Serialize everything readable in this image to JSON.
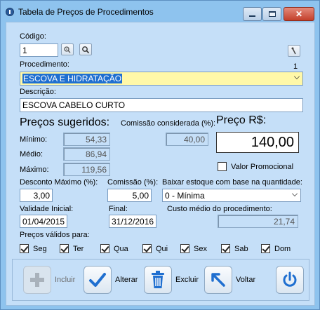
{
  "window": {
    "title": "Tabela de Preços de Procedimentos"
  },
  "codigo": {
    "label": "Código:",
    "value": "1"
  },
  "counter": "1",
  "procedimento": {
    "label": "Procedimento:",
    "value": "ESCOVA E HIDRATAÇÃO"
  },
  "descricao": {
    "label": "Descrição:",
    "value": "ESCOVA CABELO CURTO"
  },
  "precos_sugeridos": {
    "title": "Preços sugeridos:",
    "minimo_label": "Mínimo:",
    "minimo": "54,33",
    "medio_label": "Médio:",
    "medio": "86,94",
    "maximo_label": "Máximo:",
    "maximo": "119,56"
  },
  "comissao_considerada": {
    "label": "Comissão considerada (%):",
    "value": "40,00"
  },
  "preco": {
    "label": "Preço R$:",
    "value": "140,00"
  },
  "valor_promocional": {
    "label": "Valor Promocional",
    "checked": false
  },
  "desconto": {
    "label": "Desconto Máximo (%):",
    "value": "3,00"
  },
  "comissao": {
    "label": "Comissão (%):",
    "value": "5,00"
  },
  "baixar_estoque": {
    "label": "Baixar estoque com base na quantidade:",
    "value": "0 - Mínima"
  },
  "validade": {
    "label": "Validade Inicial:",
    "value": "01/04/2015"
  },
  "final": {
    "label": "Final:",
    "value": "31/12/2016"
  },
  "custo_medio": {
    "label": "Custo médio do procedimento:",
    "value": "21,74"
  },
  "precos_validos": {
    "label": "Preços válidos para:",
    "days": [
      {
        "label": "Seg",
        "checked": true
      },
      {
        "label": "Ter",
        "checked": true
      },
      {
        "label": "Qua",
        "checked": true
      },
      {
        "label": "Qui",
        "checked": true
      },
      {
        "label": "Sex",
        "checked": true
      },
      {
        "label": "Sab",
        "checked": true
      },
      {
        "label": "Dom",
        "checked": true
      }
    ]
  },
  "toolbar": {
    "incluir": "Incluir",
    "alterar": "Alterar",
    "excluir": "Excluir",
    "voltar": "Voltar"
  },
  "colors": {
    "title_bg": "#8ec3ee",
    "panel_bg": "#c5dff8",
    "close_red": "#c3402b",
    "selection": "#fff8a8",
    "check_blue": "#1f6fd0"
  },
  "icons": [
    "app-icon",
    "search-pin-icon",
    "search-icon",
    "pin-icon",
    "plus-icon",
    "check-icon",
    "trash-icon",
    "back-arrow-icon",
    "power-icon"
  ]
}
